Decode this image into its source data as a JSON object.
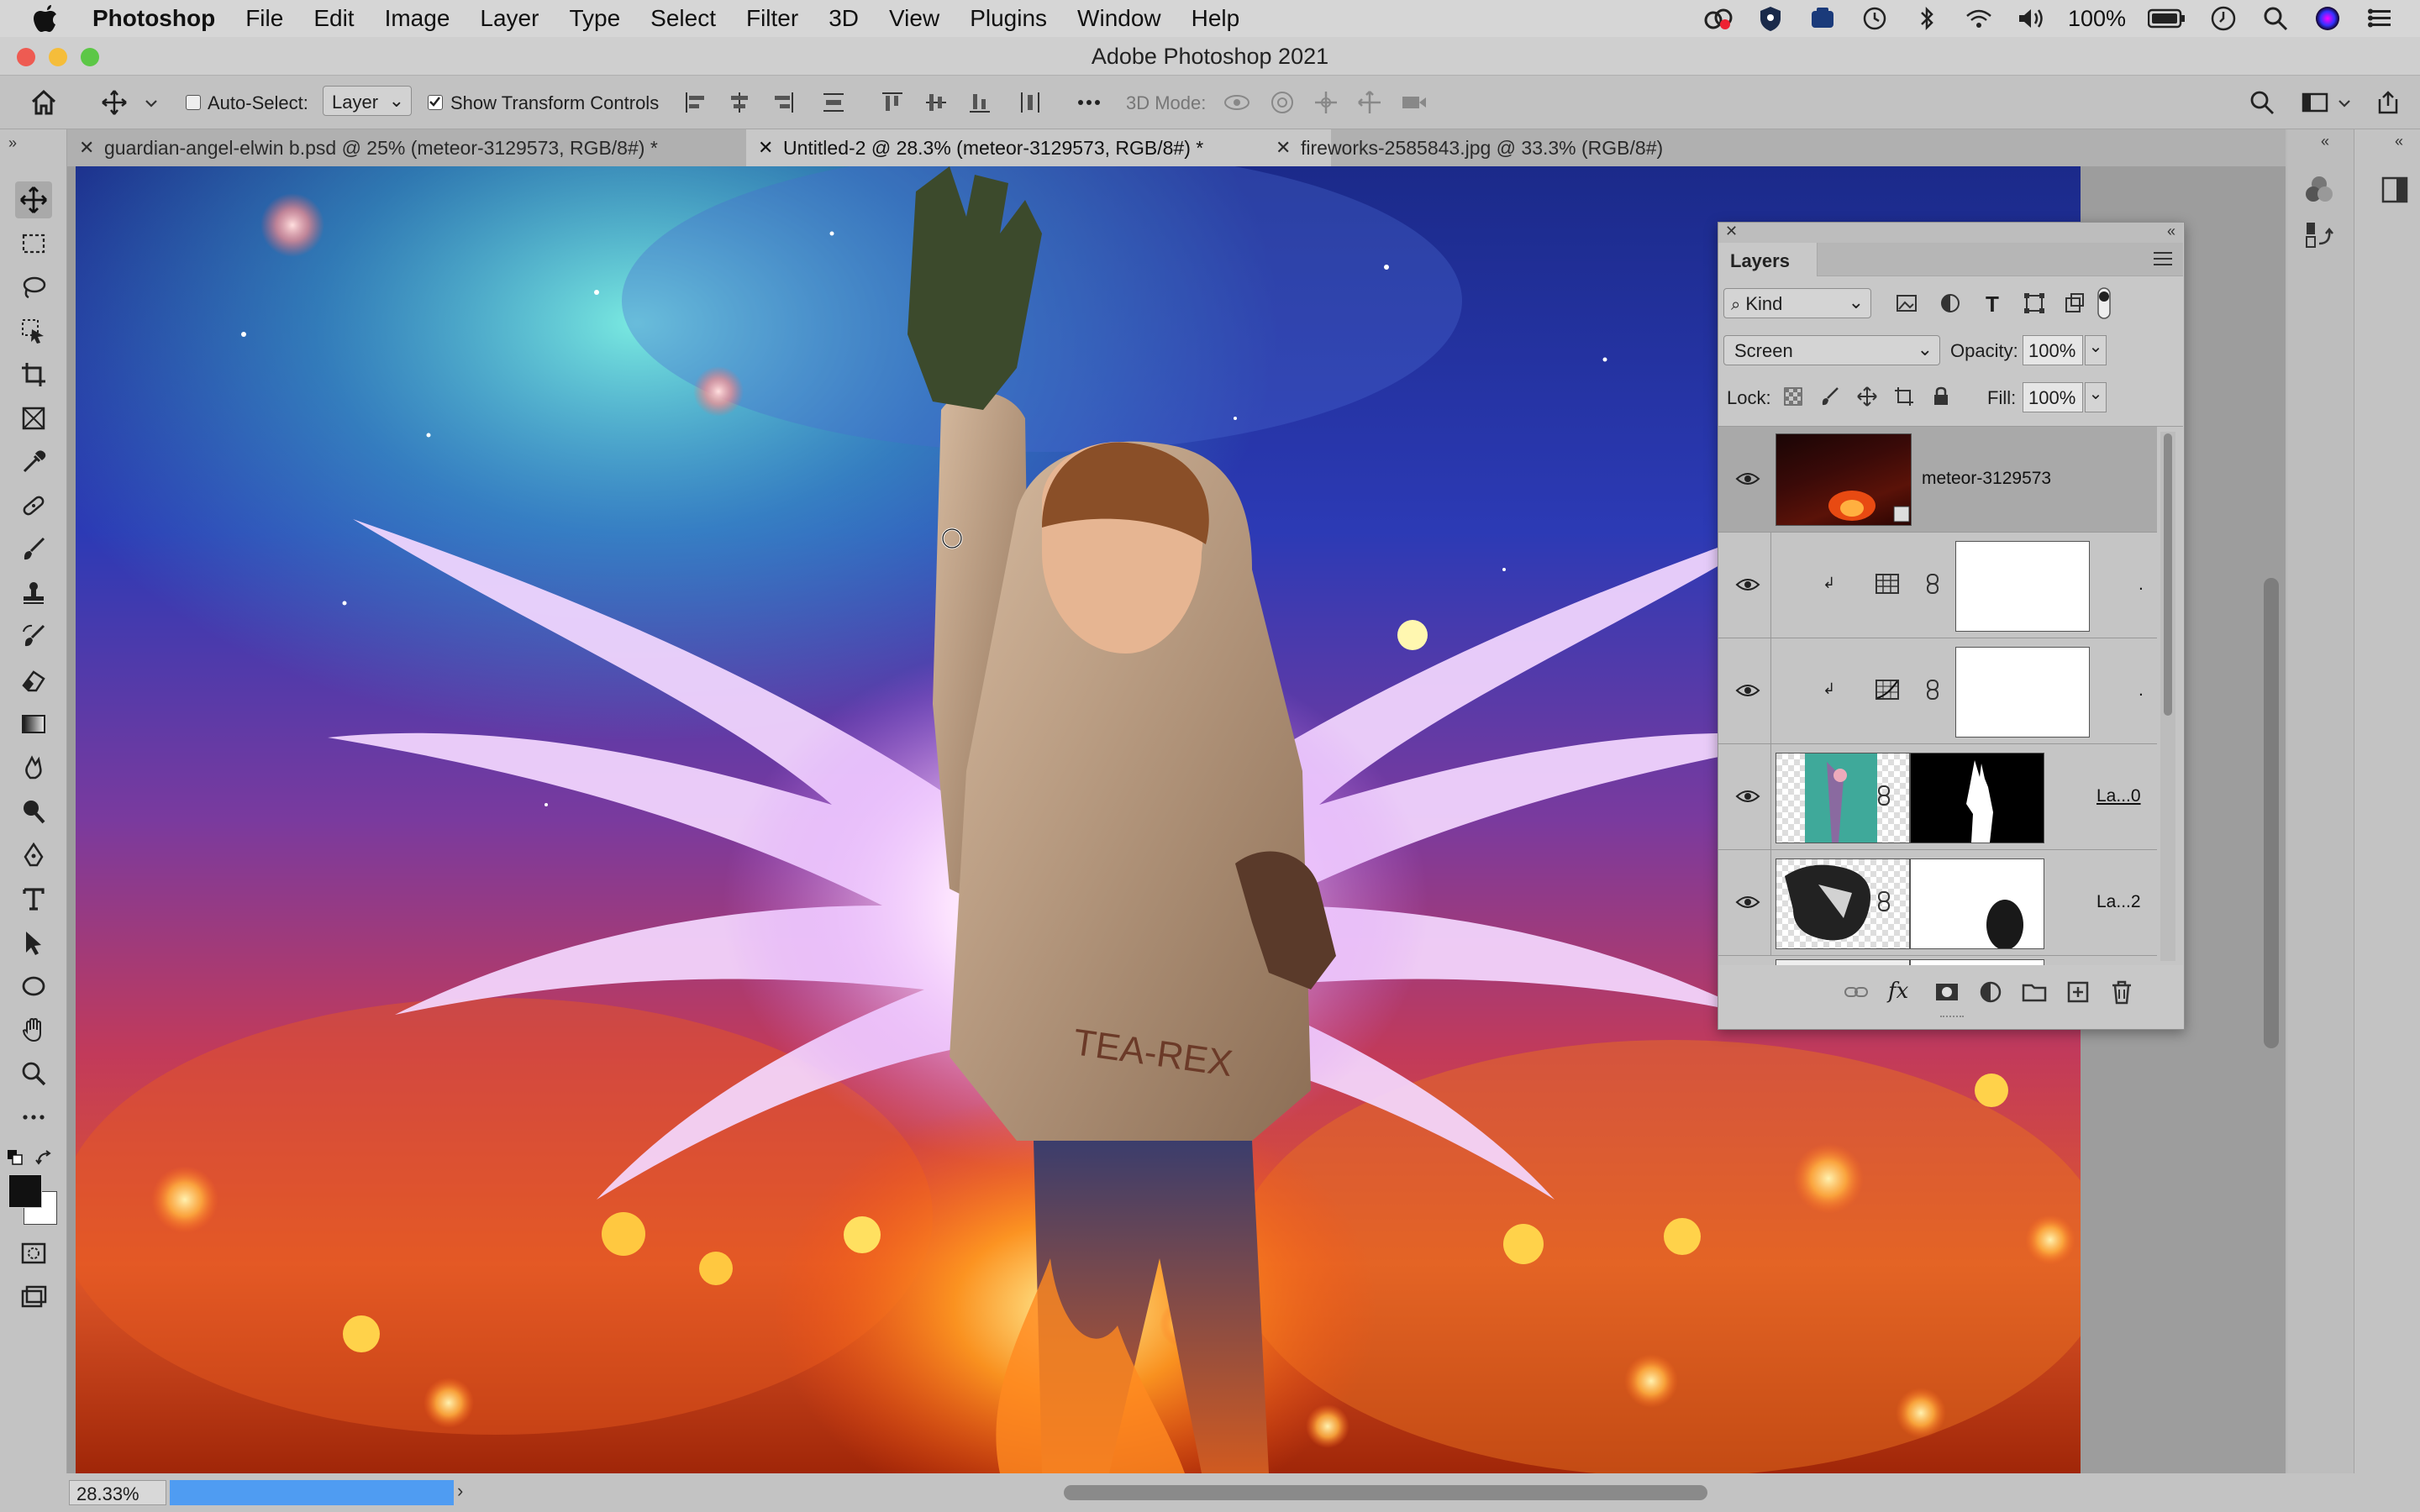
{
  "menubar": {
    "app_name": "Photoshop",
    "items": [
      "File",
      "Edit",
      "Image",
      "Layer",
      "Type",
      "Select",
      "Filter",
      "3D",
      "View",
      "Plugins",
      "Window",
      "Help"
    ],
    "battery": "100%"
  },
  "window": {
    "title": "Adobe Photoshop 2021"
  },
  "options": {
    "auto_select_label": "Auto-Select:",
    "auto_select_value": "Layer",
    "show_transform_label": "Show Transform Controls",
    "mode_3d_label": "3D Mode:"
  },
  "tabs": [
    {
      "label": "guardian-angel-elwin b.psd @ 25% (meteor-3129573, RGB/8#) *"
    },
    {
      "label": "Untitled-2 @ 28.3% (meteor-3129573, RGB/8#) *"
    },
    {
      "label": "fireworks-2585843.jpg @ 33.3% (RGB/8#)"
    }
  ],
  "layers_panel": {
    "title": "Layers",
    "filter_kind": "Kind",
    "blend_mode": "Screen",
    "opacity_label": "Opacity:",
    "opacity_value": "100%",
    "lock_label": "Lock:",
    "fill_label": "Fill:",
    "fill_value": "100%",
    "fx_label": "fx",
    "layers": [
      {
        "name": "meteor-3129573"
      },
      {
        "name": "."
      },
      {
        "name": "."
      },
      {
        "name": "La...0"
      },
      {
        "name": "La...2"
      }
    ]
  },
  "status": {
    "zoom": "28.33%"
  },
  "colors": {
    "accent": "#3d8ef0",
    "progress": "#4f9cf2"
  }
}
